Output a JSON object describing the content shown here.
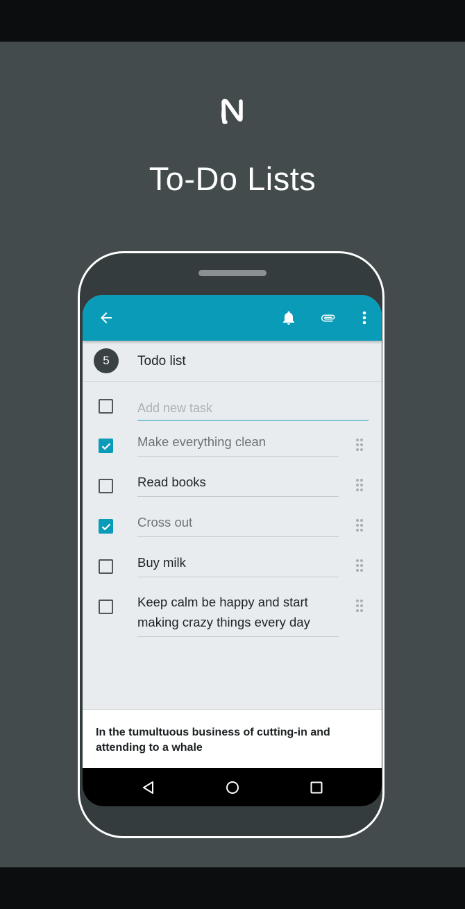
{
  "promo": {
    "logo_icon": "n-logo-icon",
    "title": "To-Do Lists"
  },
  "colors": {
    "accent": "#0a9bb8",
    "background": "#434b4d",
    "phone_frame": "#ffffff"
  },
  "toolbar": {
    "back_icon": "arrow-left-icon",
    "reminder_icon": "bell-icon",
    "attach_icon": "paperclip-icon",
    "more_icon": "more-vert-icon"
  },
  "list": {
    "count": "5",
    "title": "Todo list",
    "new_task_placeholder": "Add new task",
    "new_task_value": ""
  },
  "tasks": [
    {
      "text": "Make everything clean",
      "checked": true
    },
    {
      "text": "Read books",
      "checked": false
    },
    {
      "text": "Cross out",
      "checked": true
    },
    {
      "text": "Buy milk",
      "checked": false
    },
    {
      "text": "Keep calm be happy and start making crazy things every day",
      "checked": false
    }
  ],
  "note": {
    "text": "In the tumultuous business of cutting-in and attending to a whale"
  },
  "system_nav": {
    "back_icon": "nav-back-triangle-icon",
    "home_icon": "nav-home-circle-icon",
    "recents_icon": "nav-recents-square-icon"
  }
}
